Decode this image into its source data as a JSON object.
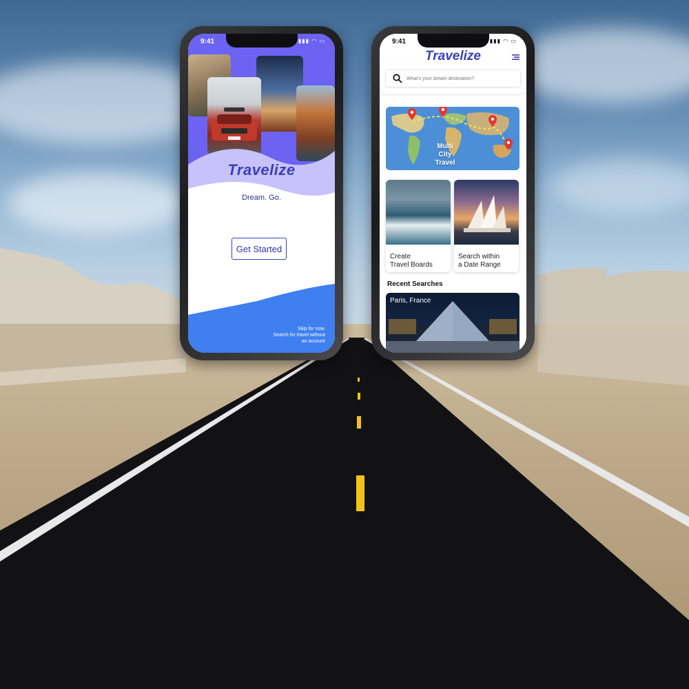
{
  "left_phone": {
    "status_time": "9:41",
    "logo": "Travelize",
    "tagline": "Dream. Go.",
    "get_started_label": "Get Started",
    "skip_line1": "Skip for now.",
    "skip_line2": "Search for travel without",
    "skip_line3": "an account"
  },
  "right_phone": {
    "status_time": "9:41",
    "logo": "Travelize",
    "search_placeholder": "What's your dream destination?",
    "map_card": {
      "line1": "Multi",
      "line2": "City",
      "line3": "Travel"
    },
    "tiles": [
      {
        "line1": "Create",
        "line2": "Travel Boards"
      },
      {
        "line1": "Search within",
        "line2": "a Date Range"
      }
    ],
    "recent_title": "Recent Searches",
    "recent_items": [
      {
        "label": "Paris, France"
      }
    ]
  },
  "colors": {
    "brand": "#3a3fb8",
    "hero_purple": "#6c63f2",
    "wave_lavender": "#c8c2fa",
    "wave_blue": "#3f7ff0",
    "pin_red": "#e0392b"
  },
  "icons": [
    "search-icon",
    "menu-icon",
    "map-pin-icon",
    "signal-icon",
    "wifi-icon",
    "battery-icon"
  ]
}
